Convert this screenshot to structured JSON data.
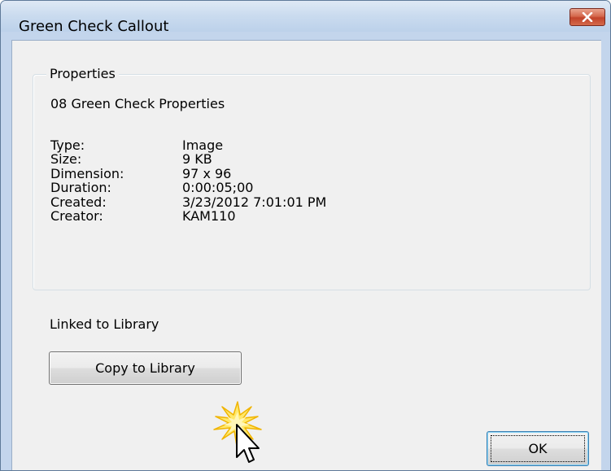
{
  "window": {
    "title": "Green Check Callout"
  },
  "properties": {
    "group_label": "Properties",
    "item_name": "08 Green Check Properties",
    "rows": [
      {
        "label": "Type:",
        "value": "Image"
      },
      {
        "label": "Size:",
        "value": "9 KB"
      },
      {
        "label": "Dimension:",
        "value": "97 x 96"
      },
      {
        "label": "Duration:",
        "value": "0:00:05;00"
      },
      {
        "label": "Created:",
        "value": "3/23/2012 7:01:01 PM"
      },
      {
        "label": "Creator:",
        "value": "KAM110"
      }
    ]
  },
  "library": {
    "status_label": "Linked to Library",
    "copy_button_label": "Copy to Library"
  },
  "footer": {
    "ok_label": "OK"
  },
  "icons": {
    "close": "close-icon",
    "cursor": "mouse-pointer-icon",
    "click_burst": "click-highlight-icon"
  },
  "colors": {
    "title_bar": "#c3d5ec",
    "close_button": "#c2432a",
    "client_background": "#f0f0f0",
    "click_highlight": "#f5c21a"
  }
}
